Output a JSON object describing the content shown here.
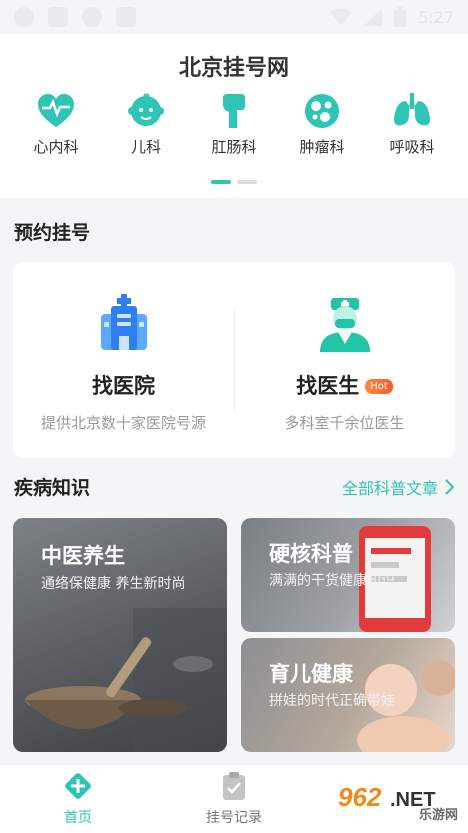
{
  "status_bar": {
    "time": "5:27"
  },
  "app_title": "北京挂号网",
  "departments": [
    {
      "label": "心内科",
      "icon": "heart-monitor-icon"
    },
    {
      "label": "儿科",
      "icon": "baby-icon"
    },
    {
      "label": "肛肠科",
      "icon": "intestine-icon"
    },
    {
      "label": "肿瘤科",
      "icon": "tumor-cells-icon"
    },
    {
      "label": "呼吸科",
      "icon": "lungs-icon"
    }
  ],
  "appointment": {
    "section_title": "预约挂号",
    "find_hospital": {
      "title": "找医院",
      "subtitle": "提供北京数十家医院号源"
    },
    "find_doctor": {
      "title": "找医生",
      "badge": "Hot",
      "subtitle": "多科室千余位医生"
    }
  },
  "knowledge": {
    "section_title": "疾病知识",
    "all_articles": "全部科普文章",
    "cards": [
      {
        "title": "中医养生",
        "subtitle": "通络保健康 养生新时尚"
      },
      {
        "title": "硬核科普",
        "subtitle": "满满的干货健康知识"
      },
      {
        "title": "育儿健康",
        "subtitle": "拼娃的时代正确带娃"
      }
    ]
  },
  "tabbar": [
    {
      "label": "首页",
      "active": true
    },
    {
      "label": "挂号记录",
      "active": false
    }
  ],
  "watermark": {
    "text": "962.NET",
    "sub": "乐游网"
  },
  "colors": {
    "accent": "#2ec4b6",
    "hot": "#f95a2c"
  }
}
